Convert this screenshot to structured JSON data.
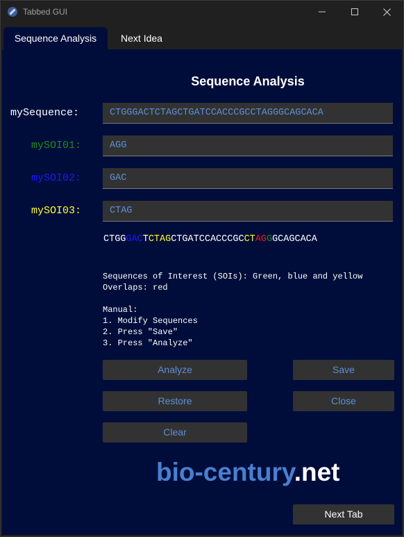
{
  "window": {
    "title": "Tabbed GUI"
  },
  "tabs": [
    {
      "label": "Sequence Analysis",
      "active": true
    },
    {
      "label": "Next Idea",
      "active": false
    }
  ],
  "main": {
    "heading": "Sequence Analysis",
    "fields": {
      "sequence": {
        "label": "mySequence:",
        "value": "CTGGGACTCTAGCTGATCCACCCGCCTAGGGCAGCACA",
        "label_color": "#ffffff"
      },
      "soi01": {
        "label": "mySOI01:",
        "value": "AGG",
        "label_color": "#1e8c1e"
      },
      "soi02": {
        "label": "mySOI02:",
        "value": "GAC",
        "label_color": "#1a1aff"
      },
      "soi03": {
        "label": "mySOI03:",
        "value": "CTAG",
        "label_color": "#ffff1e"
      }
    },
    "result_segments": [
      {
        "text": "CTGG",
        "color": "#ffffff"
      },
      {
        "text": "GAC",
        "color": "#1a1aff"
      },
      {
        "text": "T",
        "color": "#ffffff"
      },
      {
        "text": "CTAG",
        "color": "#ffff1e"
      },
      {
        "text": "CTGATCCACCCGC",
        "color": "#ffffff"
      },
      {
        "text": "CT",
        "color": "#ffff1e"
      },
      {
        "text": "AG",
        "color": "#e02020"
      },
      {
        "text": "G",
        "color": "#1e8c1e"
      },
      {
        "text": "GCAGCACA",
        "color": "#ffffff"
      }
    ],
    "info": {
      "soi_line": "Sequences of Interest (SOIs): Green, blue and yellow",
      "overlap_line": "Overlaps: red",
      "manual_title": "Manual:",
      "manual_steps": [
        "1. Modify Sequences",
        "2. Press \"Save\"",
        "3. Press \"Analyze\""
      ]
    },
    "buttons": {
      "analyze": "Analyze",
      "save": "Save",
      "restore": "Restore",
      "close": "Close",
      "clear": "Clear",
      "next_tab": "Next Tab"
    },
    "brand": {
      "part1": "bio-century",
      "part2": ".net",
      "color1": "#4a7fd0",
      "color2": "#ffffff"
    }
  },
  "colors": {
    "background": "#000d3a",
    "field_bg": "#323232",
    "field_text": "#5b8fd6",
    "titlebar": "#202020"
  }
}
